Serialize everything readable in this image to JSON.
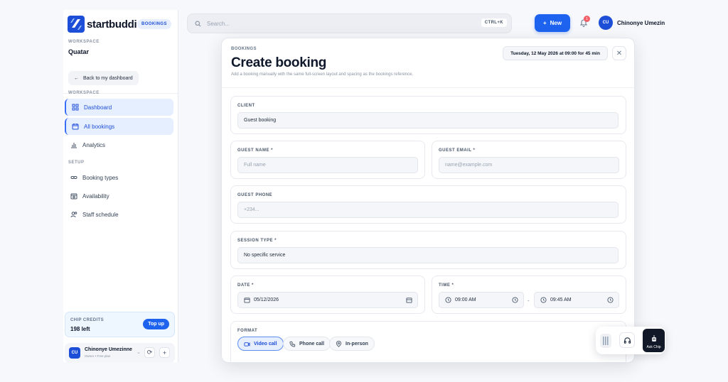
{
  "brand": {
    "name": "startbuddi",
    "badge": "BOOKINGS"
  },
  "workspace": {
    "label": "WORKSPACE",
    "name": "Quatar",
    "back_label": "Back to my dashboard"
  },
  "nav": {
    "section_workspace": "WORKSPACE",
    "section_setup": "SETUP",
    "workspace_items": [
      {
        "label": "Dashboard",
        "icon": "grid-icon",
        "active": true
      },
      {
        "label": "All bookings",
        "icon": "calendar-icon",
        "active": true
      },
      {
        "label": "Analytics",
        "icon": "bar-chart-icon",
        "active": false
      }
    ],
    "setup_items": [
      {
        "label": "Booking types",
        "icon": "link-icon"
      },
      {
        "label": "Availability",
        "icon": "calendar-clock-icon"
      },
      {
        "label": "Staff schedule",
        "icon": "users-icon"
      }
    ]
  },
  "credits": {
    "label": "CHIP CREDITS",
    "value": "198 left",
    "topup_label": "Top up"
  },
  "sidebar_user": {
    "initials": "CU",
    "name": "Chinonye Umezinne",
    "subtitle": "Owner • Free plan"
  },
  "topbar": {
    "search_placeholder": "Search...",
    "shortcut": "CTRL+K",
    "new_label": "New",
    "notification_count": "1",
    "user_initials": "CU",
    "user_name": "Chinonye Umezinne"
  },
  "modal": {
    "crumb": "BOOKINGS",
    "title": "Create booking",
    "subtitle": "Add a booking manually with the same full-screen layout and spacing as the bookings reference.",
    "time_summary": "Tuesday, 12 May 2026 at 09:00 for 45 min",
    "close_symbol": "✕",
    "client": {
      "label": "CLIENT",
      "value": "Guest booking"
    },
    "guest_name": {
      "label": "GUEST NAME *",
      "placeholder": "Full name"
    },
    "guest_email": {
      "label": "GUEST EMAIL *",
      "placeholder": "name@example.com"
    },
    "guest_phone": {
      "label": "GUEST PHONE",
      "placeholder": "+234..."
    },
    "session_type": {
      "label": "SESSION TYPE *",
      "value": "No specific service"
    },
    "date": {
      "label": "DATE *",
      "value": "05/12/2026"
    },
    "time": {
      "label": "TIME *",
      "start": "09:00 AM",
      "end": "09:45 AM",
      "separator": "-"
    },
    "format": {
      "label": "FORMAT",
      "options": [
        {
          "label": "Video call",
          "selected": true
        },
        {
          "label": "Phone call",
          "selected": false
        },
        {
          "label": "In-person",
          "selected": false
        }
      ]
    }
  },
  "dock": {
    "chip_label": "Ask Chip"
  },
  "colors": {
    "accent": "#1d63f0",
    "active_bg": "#e6efff",
    "badge_red": "#f25f67"
  }
}
